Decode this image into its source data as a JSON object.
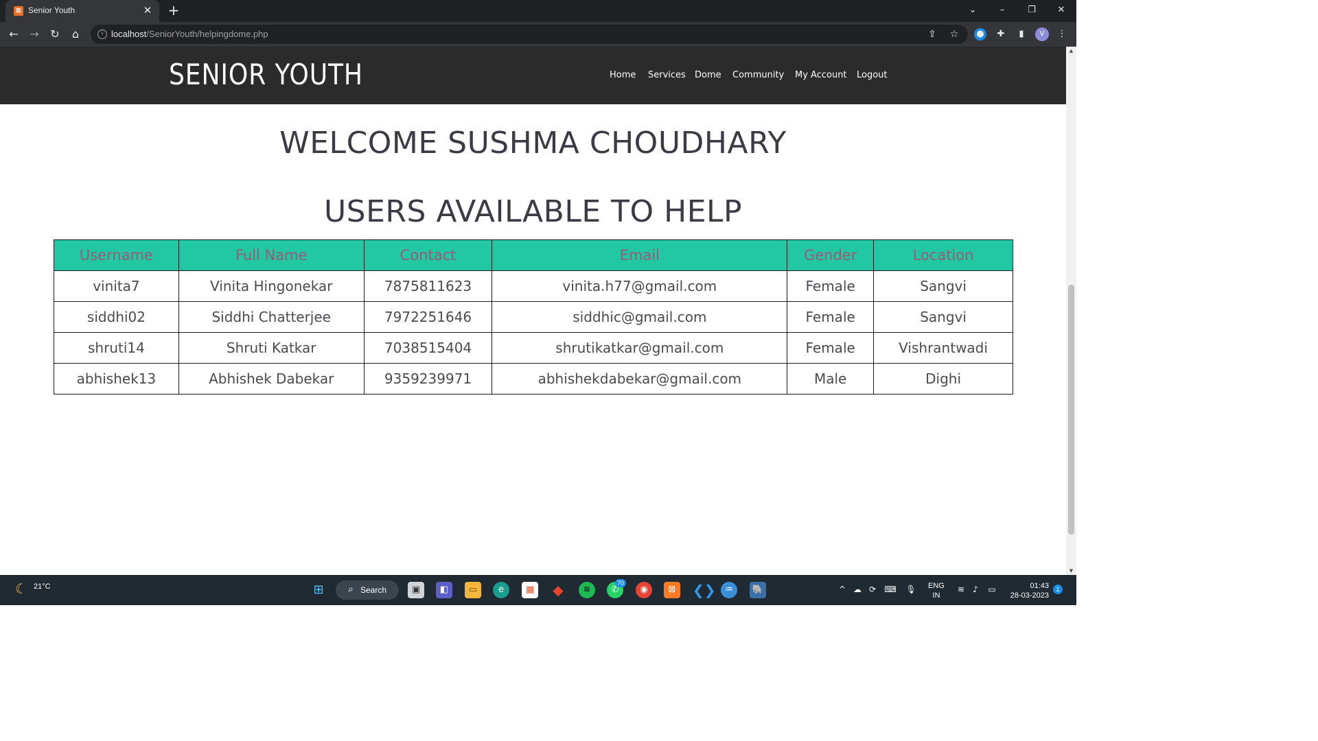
{
  "browser": {
    "tab_title": "Senior Youth",
    "tab_favicon": "xampp-icon",
    "new_tab_label": "+",
    "url_host": "localhost",
    "url_path": "/SeniorYouth/helpingdome.php",
    "profile_initial": "V"
  },
  "site": {
    "logo": "SENIOR YOUTH",
    "menu": [
      "Home",
      "Services",
      "Dome",
      "Community",
      "My Account",
      "Logout"
    ],
    "welcome": "WELCOME SUSHMA CHOUDHARY",
    "heading": "USERS AVAILABLE TO HELP",
    "colors": {
      "header_bg": "#2b2b2b",
      "table_header_bg": "#22c7a4",
      "table_header_text": "#9c5a78",
      "heading_text": "#3b3b46"
    }
  },
  "table": {
    "columns": [
      "Username",
      "Full Name",
      "Contact",
      "Email",
      "Gender",
      "Location"
    ],
    "rows": [
      [
        "vinita7",
        "Vinita Hingonekar",
        "7875811623",
        "vinita.h77@gmail.com",
        "Female",
        "Sangvi"
      ],
      [
        "siddhi02",
        "Siddhi Chatterjee",
        "7972251646",
        "siddhic@gmail.com",
        "Female",
        "Sangvi"
      ],
      [
        "shruti14",
        "Shruti Katkar",
        "7038515404",
        "shrutikatkar@gmail.com",
        "Female",
        "Vishrantwadi"
      ],
      [
        "abhishek13",
        "Abhishek Dabekar",
        "9359239971",
        "abhishekdabekar@gmail.com",
        "Male",
        "Dighi"
      ]
    ]
  },
  "taskbar": {
    "weather_temp": "21°C",
    "search_label": "Search",
    "whatsapp_badge": "70",
    "lang_line1": "ENG",
    "lang_line2": "IN",
    "time": "01:43",
    "date": "28-03-2023",
    "notification_count": "1"
  }
}
